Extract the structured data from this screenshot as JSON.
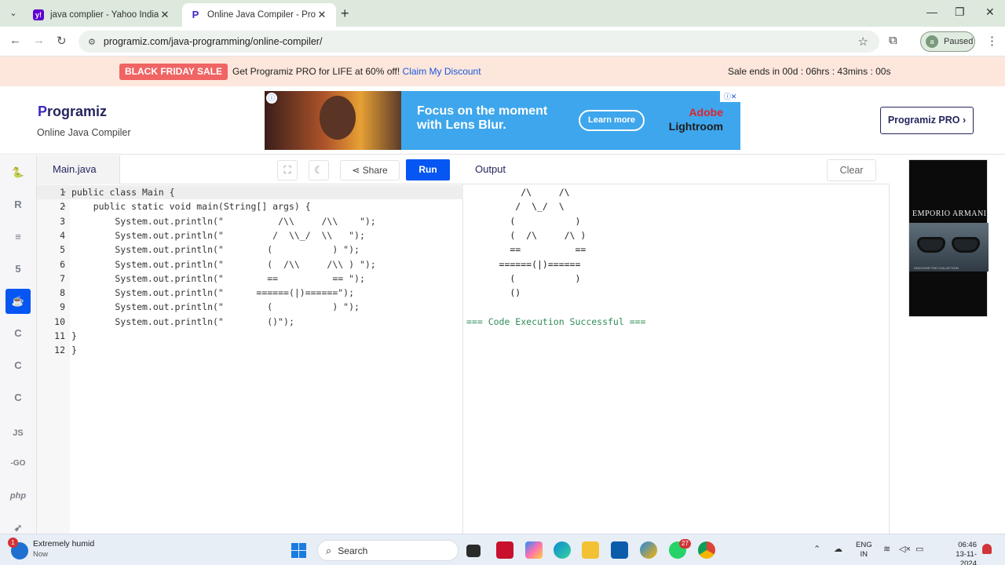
{
  "browser": {
    "tabs": [
      {
        "title": "java complier - Yahoo India Sea",
        "favicon": "yahoo-icon"
      },
      {
        "title": "Online Java Compiler - Program",
        "favicon": "programiz-icon"
      }
    ],
    "url": "programiz.com/java-programming/online-compiler/",
    "profile_status": "Paused",
    "profile_initial": "a"
  },
  "promo": {
    "badge": "BLACK FRIDAY SALE",
    "text": "Get Programiz PRO for LIFE at 60% off!",
    "link": "Claim My Discount",
    "timer": "Sale ends in 00d : 06hrs : 43mins : 00s"
  },
  "header": {
    "logo_first": "P",
    "logo_rest": "rogramiz",
    "subtitle": "Online Java Compiler",
    "pro_button": "Programiz PRO ›"
  },
  "ad": {
    "headline": "Focus on the moment with Lens Blur.",
    "button": "Learn more",
    "brand_top": "Adobe",
    "brand_bottom": "Lightroom"
  },
  "editor": {
    "file_name": "Main.java",
    "share_label": "Share",
    "run_label": "Run",
    "lines": [
      {
        "n": "1",
        "text": "public class Main {"
      },
      {
        "n": "2",
        "text": "    public static void main(String[] args) {"
      },
      {
        "n": "3",
        "text": "        System.out.println(\"          /\\\\     /\\\\    \");"
      },
      {
        "n": "4",
        "text": "        System.out.println(\"         /  \\\\_/  \\\\   \");"
      },
      {
        "n": "5",
        "text": "        System.out.println(\"        (           ) \");"
      },
      {
        "n": "6",
        "text": "        System.out.println(\"        (  /\\\\     /\\\\ ) \");"
      },
      {
        "n": "7",
        "text": "        System.out.println(\"        ==          == \");"
      },
      {
        "n": "8",
        "text": "        System.out.println(\"      ======(|)======\");"
      },
      {
        "n": "9",
        "text": "        System.out.println(\"        (           ) \");"
      },
      {
        "n": "10",
        "text": "        System.out.println(\"        ()\");"
      },
      {
        "n": "11",
        "text": "}"
      },
      {
        "n": "12",
        "text": "}"
      }
    ]
  },
  "output": {
    "title": "Output",
    "clear_label": "Clear",
    "lines": [
      "          /\\     /\\",
      "         /  \\_/  \\",
      "        (           )",
      "        (  /\\     /\\ )",
      "        ==          ==",
      "      ======(|)======",
      "        (           )",
      "        ()",
      "",
      "=== Code Execution Successful ==="
    ]
  },
  "side_ad": {
    "brand": "EMPORIO ARMANI",
    "cta": "DISCOVER THE COLLECTION"
  },
  "rail": {
    "items": [
      {
        "name": "python-icon",
        "glyph": "🐍"
      },
      {
        "name": "r-icon",
        "glyph": "R"
      },
      {
        "name": "sql-icon",
        "glyph": "≡"
      },
      {
        "name": "html-icon",
        "glyph": "5"
      },
      {
        "name": "java-icon",
        "glyph": "☕"
      },
      {
        "name": "c-icon",
        "glyph": "C"
      },
      {
        "name": "cpp-icon",
        "glyph": "C"
      },
      {
        "name": "csharp-icon",
        "glyph": "C"
      },
      {
        "name": "js-icon",
        "glyph": "JS"
      },
      {
        "name": "go-icon",
        "glyph": "-GO"
      },
      {
        "name": "php-icon",
        "glyph": "php"
      },
      {
        "name": "swift-icon",
        "glyph": "➶"
      }
    ]
  },
  "taskbar": {
    "weather_title": "Extremely humid",
    "weather_sub": "Now",
    "weather_badge": "1",
    "search_placeholder": "Search",
    "whatsapp_badge": "27",
    "lang_top": "ENG",
    "lang_bottom": "IN",
    "time": "06:46",
    "date": "13-11-2024"
  },
  "colors": {
    "run_button": "#0556f3",
    "promo_badge": "#f06464",
    "success_text": "#2e8b57"
  }
}
